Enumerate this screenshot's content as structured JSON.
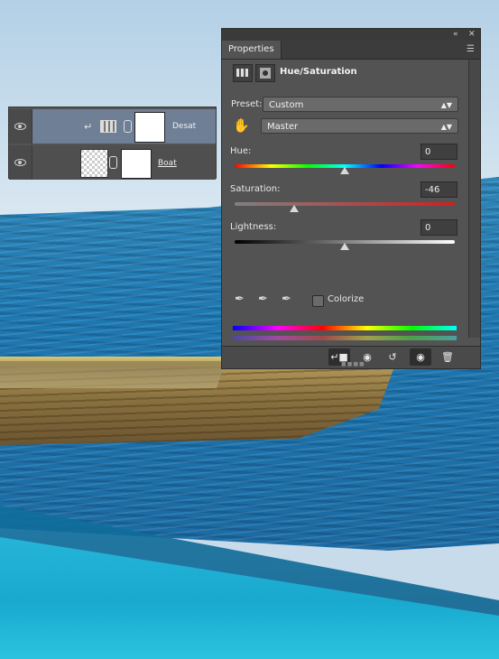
{
  "layers_panel": {
    "layers": [
      {
        "name": "Desat",
        "selected": true,
        "clipped": true
      },
      {
        "name": "Boat",
        "selected": false
      }
    ]
  },
  "properties_panel": {
    "tab": "Properties",
    "collapse_icon": "double-chevron-icon",
    "close_icon": "close-icon",
    "menu_icon": "panel-menu-icon",
    "adjustment_title": "Hue/Saturation",
    "preset_label": "Preset:",
    "preset_value": "Custom",
    "channel_value": "Master",
    "hue_label": "Hue:",
    "hue_value": "0",
    "saturation_label": "Saturation:",
    "saturation_value": "-46",
    "lightness_label": "Lightness:",
    "lightness_value": "0",
    "colorize_label": "Colorize",
    "colorize_checked": false,
    "hue_slider_fraction": 0.5,
    "saturation_slider_fraction": 0.27,
    "lightness_slider_fraction": 0.5,
    "footer_buttons": [
      "clip-to-layer-icon",
      "view-previous-icon",
      "reset-icon",
      "visibility-eye-icon",
      "trash-icon"
    ]
  }
}
